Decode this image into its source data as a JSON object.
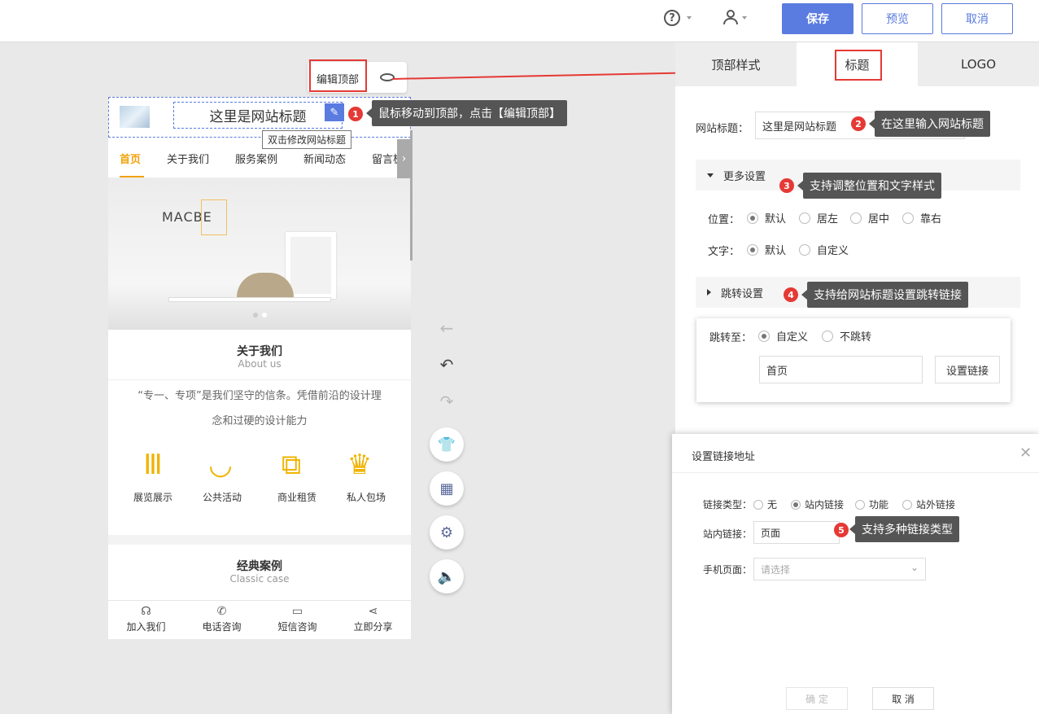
{
  "header": {
    "help_icon": "question-circle-icon",
    "user_icon": "user-icon",
    "save_label": "保存",
    "preview_label": "预览",
    "cancel_label": "取消"
  },
  "phone": {
    "site_title": "这里是网站标题",
    "dbl_tip": "双击修改网站标题",
    "nav": [
      "首页",
      "关于我们",
      "服务案例",
      "新闻动态",
      "留言板"
    ],
    "banner_brand": "MACBE",
    "about": {
      "title": "关于我们",
      "subtitle": "About us",
      "text_line1": "“专一、专项”是我们坚守的信条。凭借前沿的设计理",
      "text_line2": "念和过硬的设计能力"
    },
    "features": [
      "展览展示",
      "公共活动",
      "商业租赁",
      "私人包场"
    ],
    "cases": {
      "title": "经典案例",
      "subtitle": "Classic case"
    },
    "bottom": [
      "加入我们",
      "电话咨询",
      "短信咨询",
      "立即分享"
    ]
  },
  "edit_top": {
    "label": "编辑顶部"
  },
  "annotations": {
    "a1": {
      "num": "1",
      "text": "鼠标移动到顶部，点击【编辑顶部】"
    },
    "a2": {
      "num": "2",
      "text": "在这里输入网站标题"
    },
    "a3": {
      "num": "3",
      "text": "支持调整位置和文字样式"
    },
    "a4": {
      "num": "4",
      "text": "支持给网站标题设置跳转链接"
    },
    "a5": {
      "num": "5",
      "text": "支持多种链接类型"
    }
  },
  "panel": {
    "tabs": [
      "顶部样式",
      "标题",
      "LOGO"
    ],
    "site_title_label": "网站标题：",
    "site_title_value": "这里是网站标题",
    "more_settings": "更多设置",
    "position_label": "位置：",
    "position_options": [
      "默认",
      "居左",
      "居中",
      "靠右"
    ],
    "text_label": "文字：",
    "text_options": [
      "默认",
      "自定义"
    ],
    "jump_settings": "跳转设置",
    "jump_to_label": "跳转至：",
    "jump_options": [
      "自定义",
      "不跳转"
    ],
    "jump_value": "首页",
    "set_link_button": "设置链接"
  },
  "dialog": {
    "title": "设置链接地址",
    "link_type_label": "链接类型：",
    "link_types": [
      "无",
      "站内链接",
      "功能",
      "站外链接"
    ],
    "site_link_label": "站内链接：",
    "site_link_value": "页面",
    "mobile_page_label": "手机页面：",
    "mobile_page_placeholder": "请选择",
    "confirm": "确 定",
    "cancel": "取 消"
  }
}
